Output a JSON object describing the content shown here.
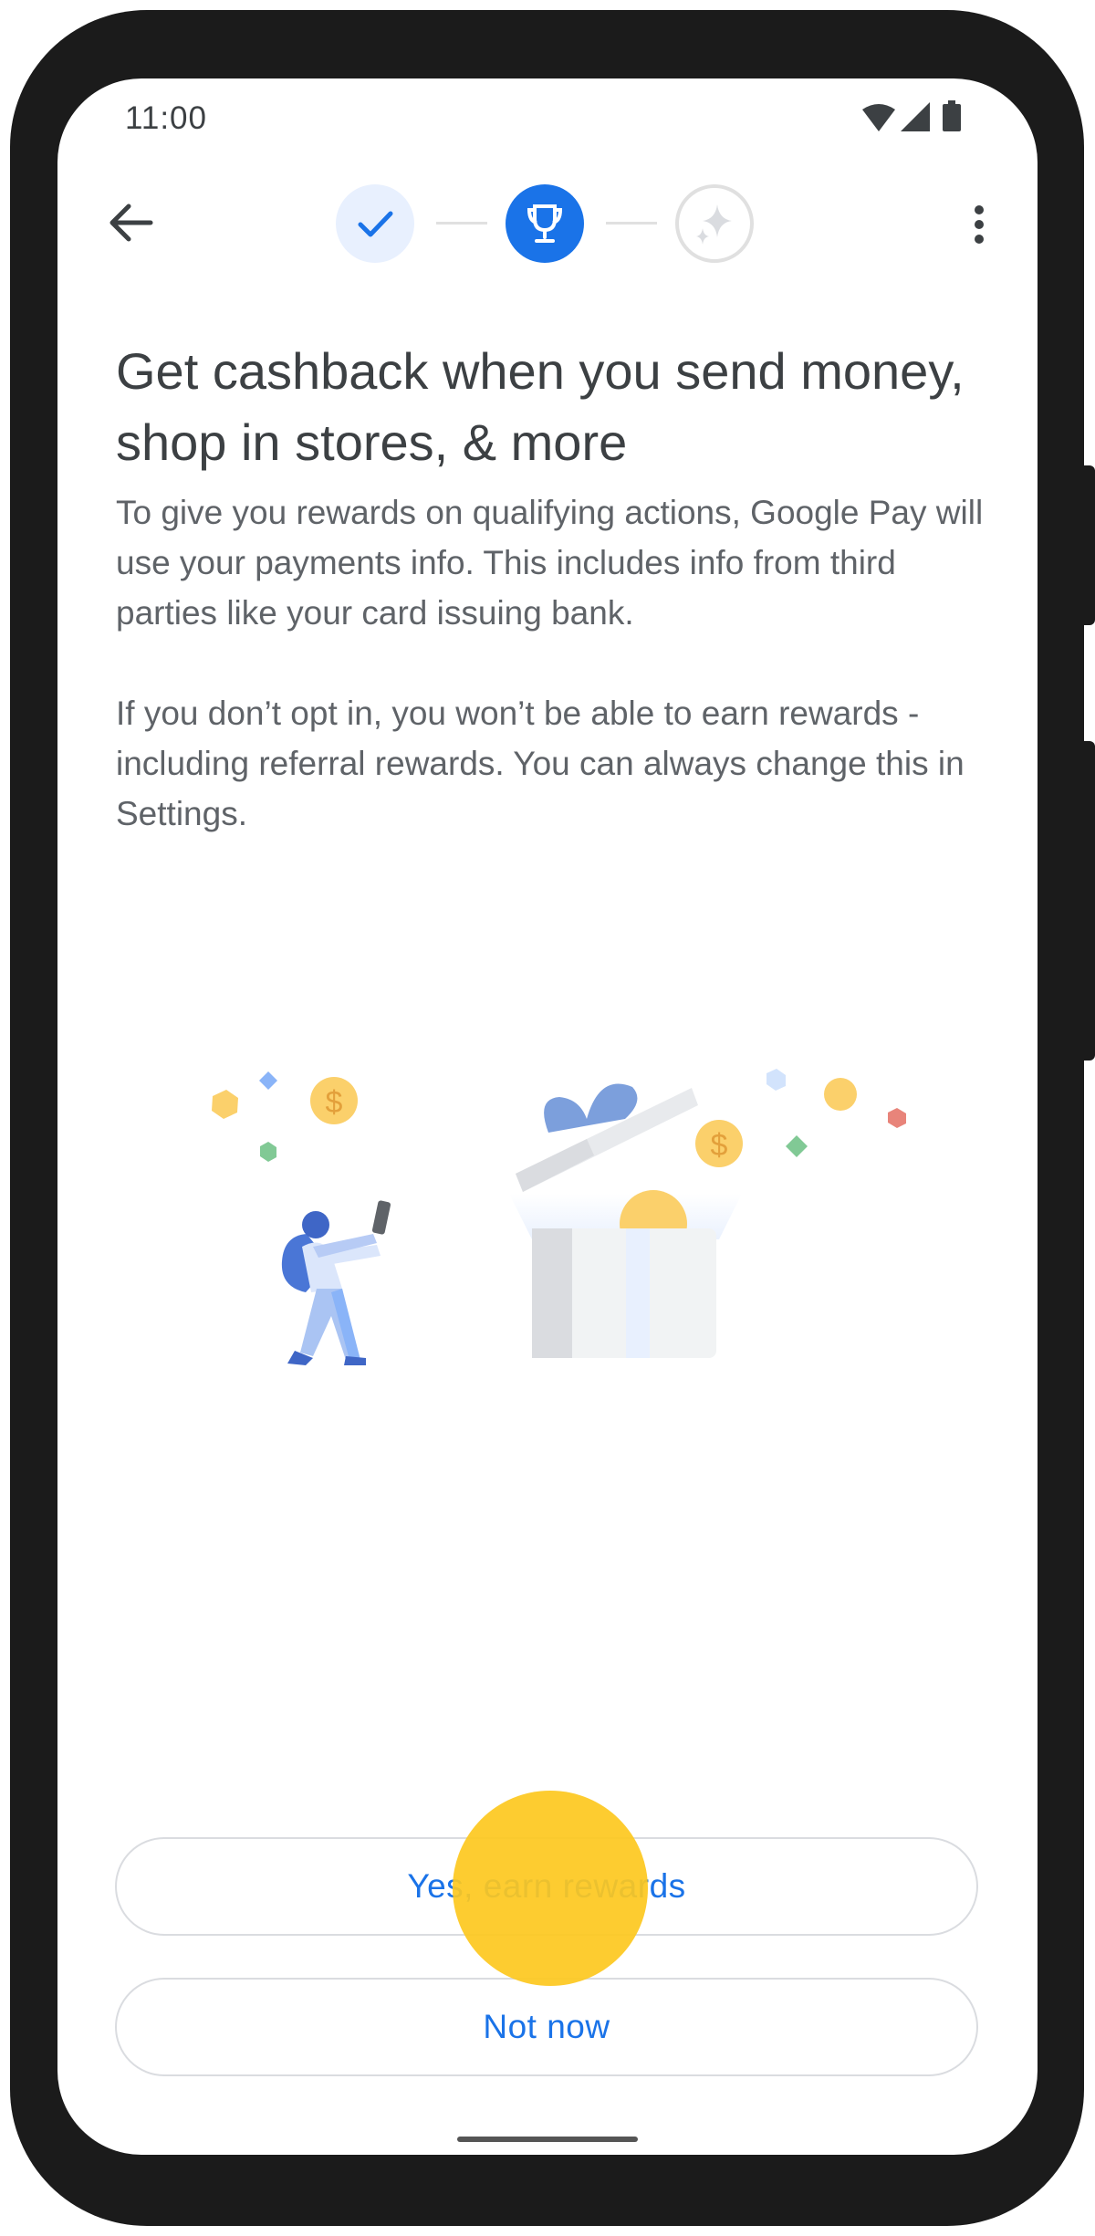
{
  "status_bar": {
    "time": "11:00",
    "icons": [
      "wifi-icon",
      "cellular-signal-icon",
      "battery-icon"
    ]
  },
  "top_bar": {
    "back_icon": "arrow-back-icon",
    "menu_icon": "more-vert-icon",
    "steps": [
      {
        "icon": "check-icon",
        "state": "done"
      },
      {
        "icon": "trophy-icon",
        "state": "current"
      },
      {
        "icon": "sparkle-icon",
        "state": "upcoming"
      }
    ]
  },
  "content": {
    "headline": "Get cashback when you send money, shop in stores, & more",
    "paragraph_1": "To give you rewards on qualifying actions, Google Pay will use your payments info. This includes info from third parties like your card issuing bank.",
    "paragraph_2": "If you don’t opt in, you won’t be able to earn rewards - including referral rewards. You can always change this in Settings."
  },
  "illustration": {
    "coin_symbol": "$"
  },
  "actions": {
    "primary_label": "Yes, earn rewards",
    "secondary_label": "Not now"
  },
  "colors": {
    "accent": "#1a73e8",
    "headline_text": "#3c4043",
    "body_text": "#5f6368",
    "touch_indicator": "#fdc81e",
    "device_frame": "#1b1b1b"
  }
}
